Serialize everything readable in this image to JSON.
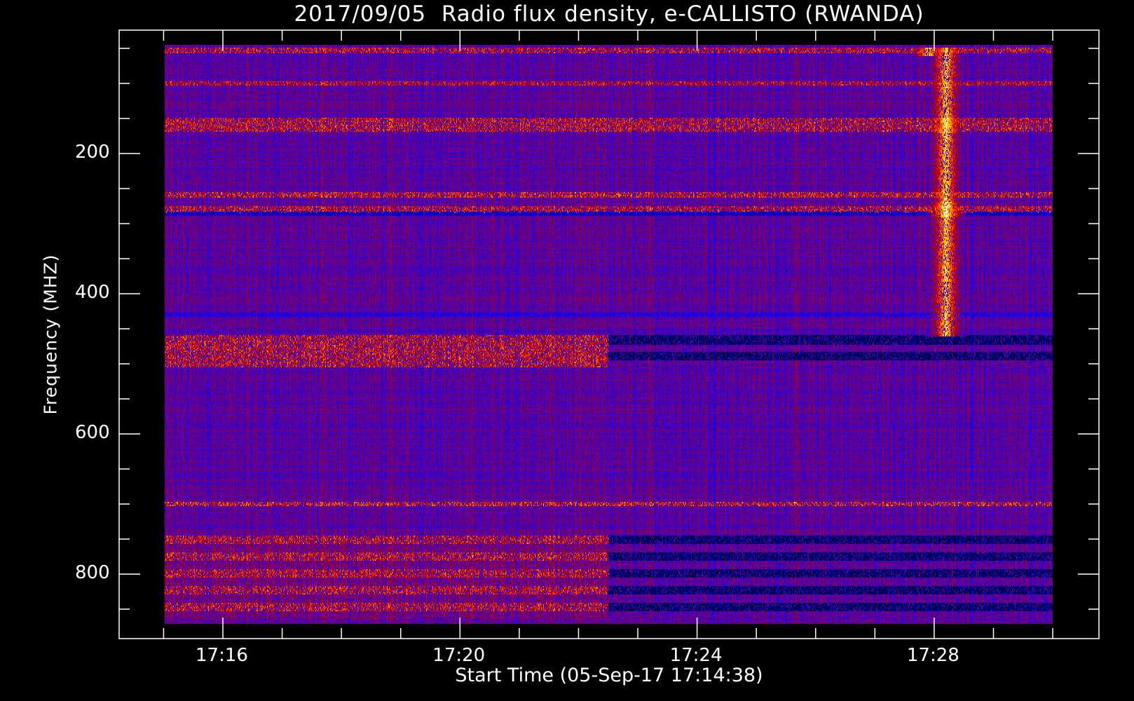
{
  "chart_data": {
    "type": "heatmap",
    "title": "2017/09/05  Radio flux density, e-CALLISTO (RWANDA)",
    "xlabel": "Start Time (05-Sep-17 17:14:38)",
    "ylabel": "Frequency (MHZ)",
    "x_unit": "minutes after 17:00",
    "xlim": [
      14.25,
      30.78
    ],
    "data_xrange": [
      15.0,
      30.0
    ],
    "ylim": [
      892,
      24
    ],
    "data_yrange": [
      45,
      871
    ],
    "x_ticks": [
      {
        "value": 16,
        "label": "17:16"
      },
      {
        "value": 20,
        "label": "17:20"
      },
      {
        "value": 24,
        "label": "17:24"
      },
      {
        "value": 28,
        "label": "17:28"
      }
    ],
    "x_minor_step": 1,
    "y_ticks": [
      {
        "value": 200,
        "label": "200"
      },
      {
        "value": 400,
        "label": "400"
      },
      {
        "value": 600,
        "label": "600"
      },
      {
        "value": 800,
        "label": "800"
      }
    ],
    "y_minor_step": 50,
    "colormap": [
      "#000000",
      "#000080",
      "#0000ff",
      "#4000c0",
      "#800060",
      "#c00000",
      "#ff4000",
      "#ffd000",
      "#ffffff"
    ],
    "background_level": 0.42,
    "bands": [
      {
        "freq": [
          50,
          56
        ],
        "level": 0.62,
        "t_from": 15.0,
        "t_to": 30.0
      },
      {
        "freq": [
          97,
          103
        ],
        "level": 0.6,
        "t_from": 15.0,
        "t_to": 30.0
      },
      {
        "freq": [
          150,
          168
        ],
        "level": 0.62,
        "t_from": 15.0,
        "t_to": 30.0
      },
      {
        "freq": [
          256,
          262
        ],
        "level": 0.64,
        "t_from": 15.0,
        "t_to": 30.0
      },
      {
        "freq": [
          276,
          284
        ],
        "level": 0.62,
        "t_from": 15.0,
        "t_to": 30.0
      },
      {
        "freq": [
          284,
          288
        ],
        "level": 0.15,
        "t_from": 15.0,
        "t_to": 30.0
      },
      {
        "freq": [
          428,
          432
        ],
        "level": 0.25,
        "t_from": 15.0,
        "t_to": 30.0
      },
      {
        "freq": [
          460,
          505
        ],
        "level": 0.62,
        "t_from": 15.0,
        "t_to": 22.5
      },
      {
        "freq": [
          460,
          505
        ],
        "level": 0.05,
        "t_from": 22.5,
        "t_to": 30.0,
        "striped": true
      },
      {
        "freq": [
          698,
          702
        ],
        "level": 0.66,
        "t_from": 15.0,
        "t_to": 30.0
      },
      {
        "freq": [
          745,
          865
        ],
        "level": 0.62,
        "t_from": 15.0,
        "t_to": 22.5,
        "striped": true
      },
      {
        "freq": [
          745,
          865
        ],
        "level": 0.05,
        "t_from": 22.5,
        "t_to": 30.0,
        "striped": true
      }
    ],
    "bursts": [
      {
        "time": 28.2,
        "freq": [
          50,
          460
        ],
        "level": 0.9
      },
      {
        "time": 28.2,
        "freq": [
          270,
          290
        ],
        "level": 1.0
      },
      {
        "time": 28.2,
        "freq": [
          150,
          170
        ],
        "level": 0.95
      },
      {
        "time": 27.9,
        "freq": [
          50,
          60
        ],
        "level": 0.9
      }
    ]
  }
}
